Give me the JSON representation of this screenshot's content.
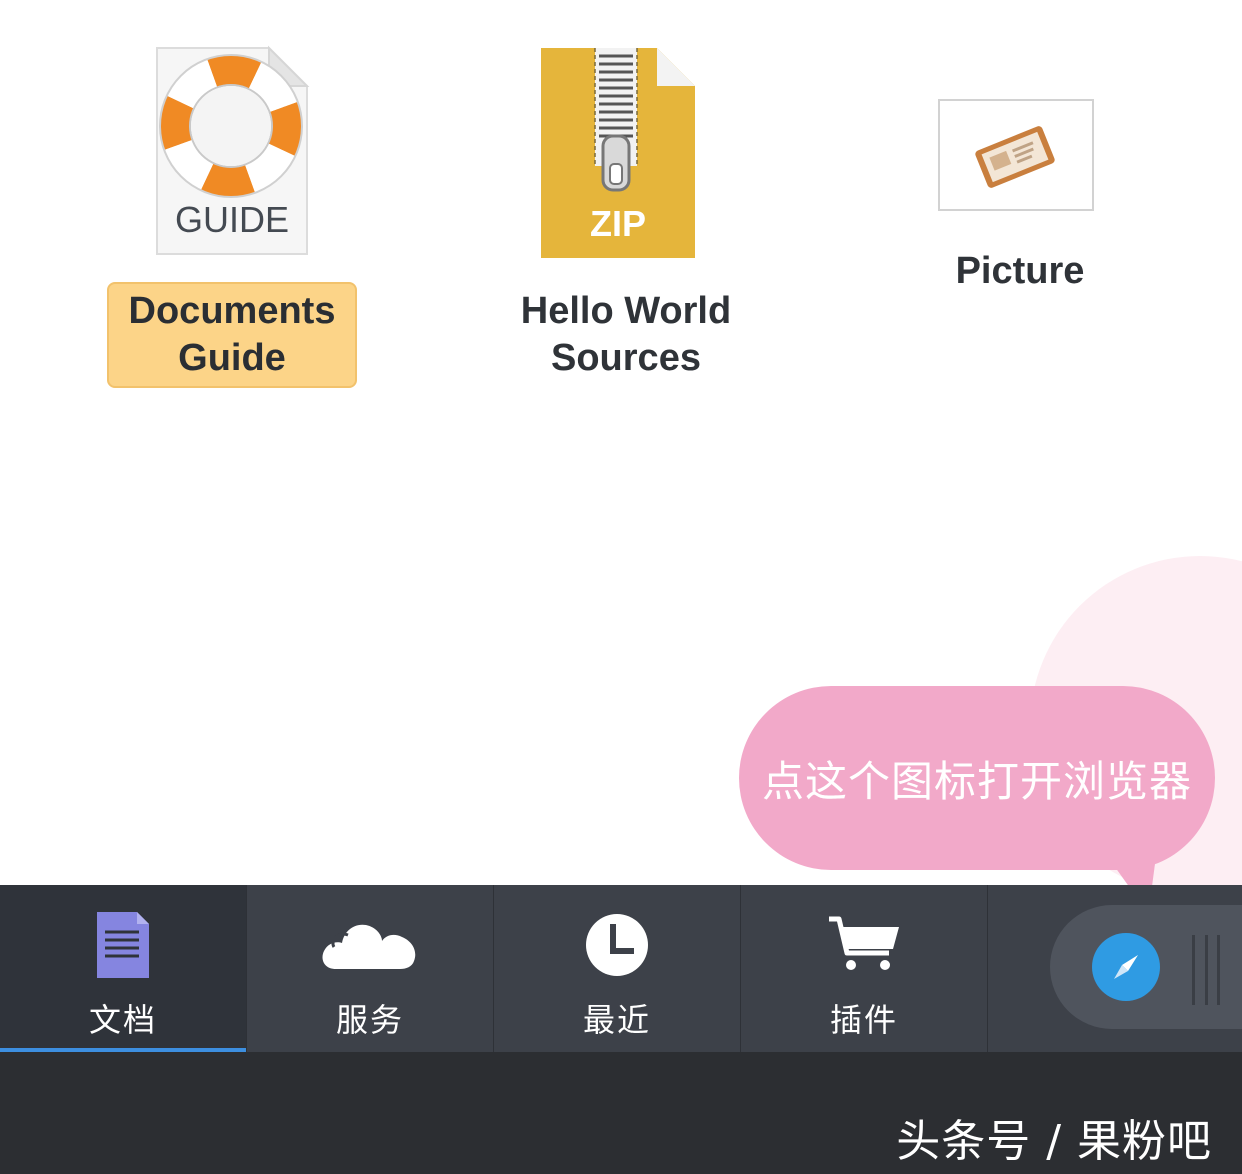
{
  "files": [
    {
      "icon_text": "GUIDE",
      "label_lines": [
        "Documents",
        "Guide"
      ],
      "selected": true,
      "icon": "lifebuoy-document-icon"
    },
    {
      "icon_text": "ZIP",
      "label_lines": [
        "Hello World",
        "Sources"
      ],
      "selected": false,
      "icon": "zip-archive-icon"
    },
    {
      "icon_text": "",
      "label_lines": [
        "Picture"
      ],
      "selected": false,
      "icon": "picture-thumbnail-icon"
    }
  ],
  "tooltip": {
    "text": "点这个图标打开浏览器"
  },
  "tabbar": {
    "tabs": [
      {
        "label": "文档",
        "icon": "document-icon",
        "active": true
      },
      {
        "label": "服务",
        "icon": "cloud-icon",
        "active": false
      },
      {
        "label": "最近",
        "icon": "clock-icon",
        "active": false
      },
      {
        "label": "插件",
        "icon": "cart-icon",
        "active": false
      }
    ],
    "browser_button_icon": "compass-icon",
    "active_indicator_color": "#3d8fe0",
    "compass_color": "#2f9be3"
  },
  "watermark": {
    "text": "头条号 / 果粉吧"
  },
  "colors": {
    "selection": "#fcd488",
    "tooltip": "#f2a9c9",
    "tabbar": "#3d4149",
    "zip": "#e5b53b",
    "guide_orange": "#f08a24"
  }
}
